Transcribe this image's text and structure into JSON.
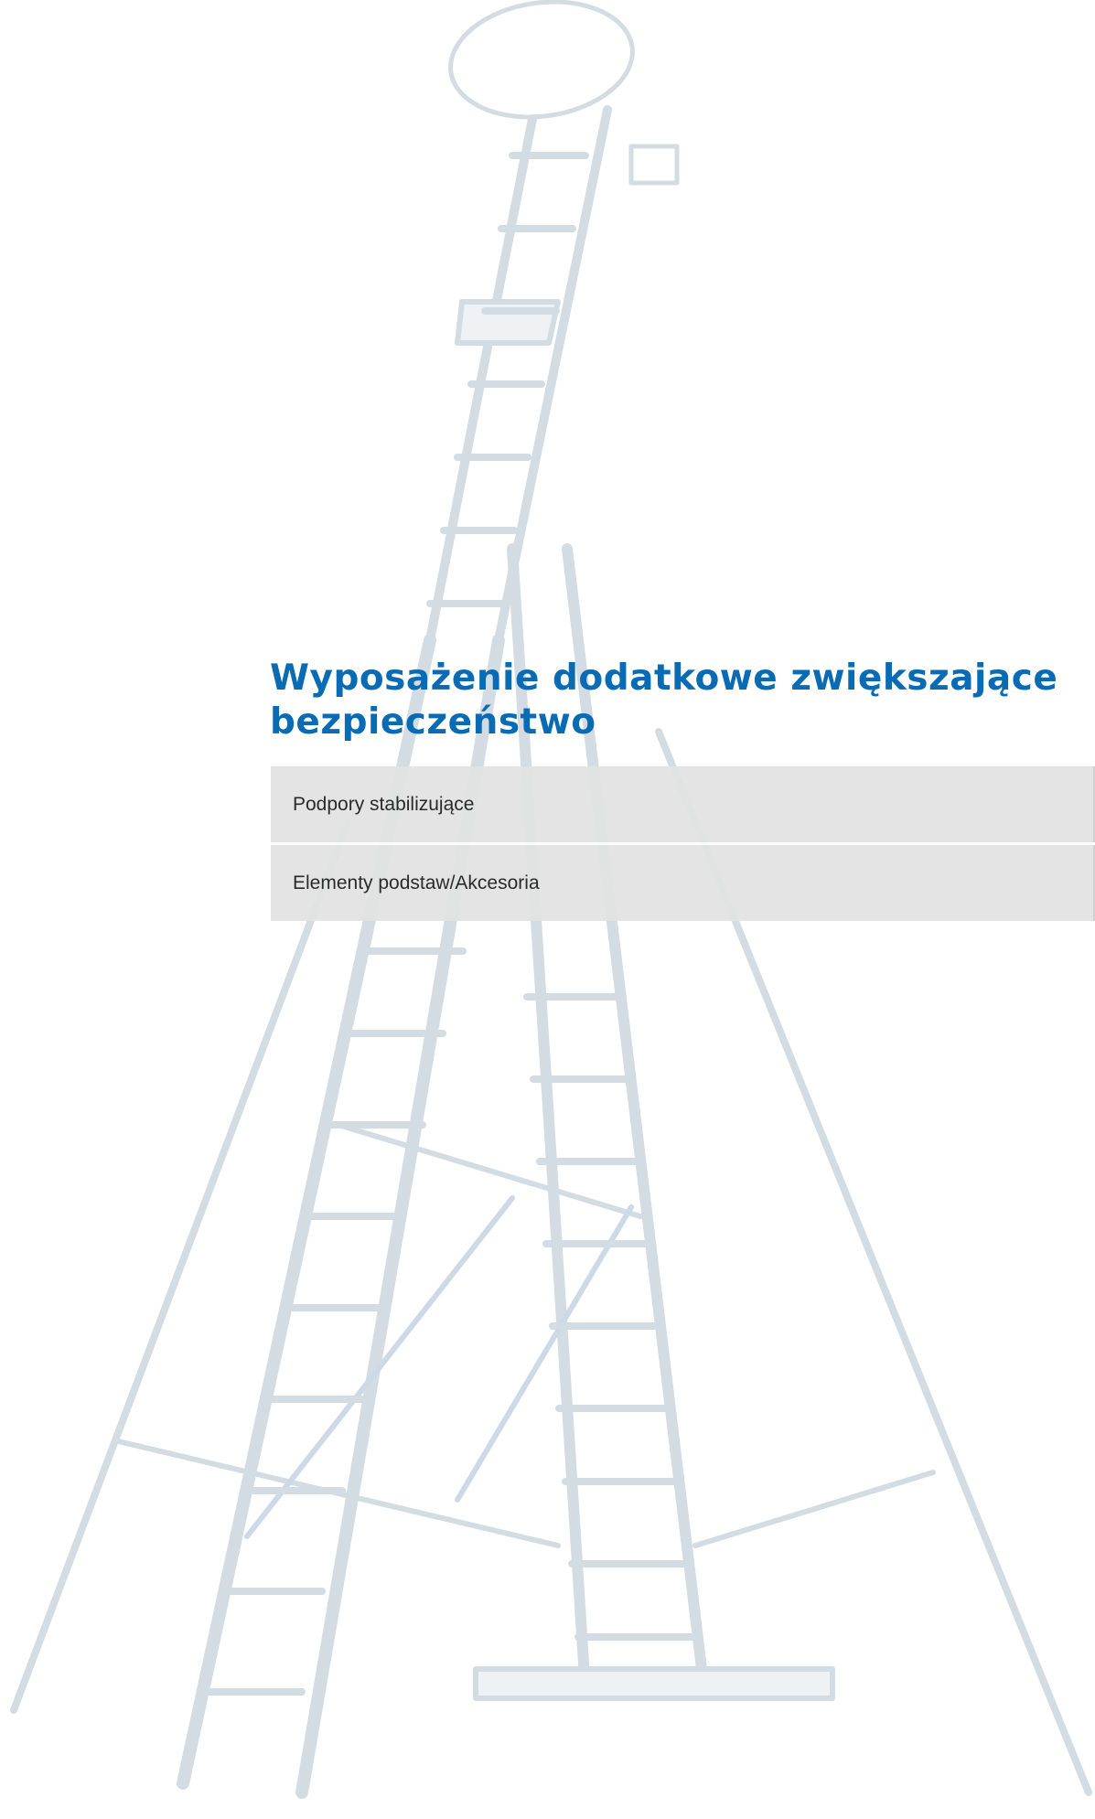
{
  "page": {
    "heading": "Wyposażenie dodatkowe zwiększające bezpieczeństwo",
    "accent_color": "#0a6bb5",
    "background_image": "ladder-illustration"
  },
  "menu": {
    "items": [
      {
        "label": "Podpory stabilizujące"
      },
      {
        "label": "Elementy podstaw/Akcesoria"
      }
    ]
  }
}
